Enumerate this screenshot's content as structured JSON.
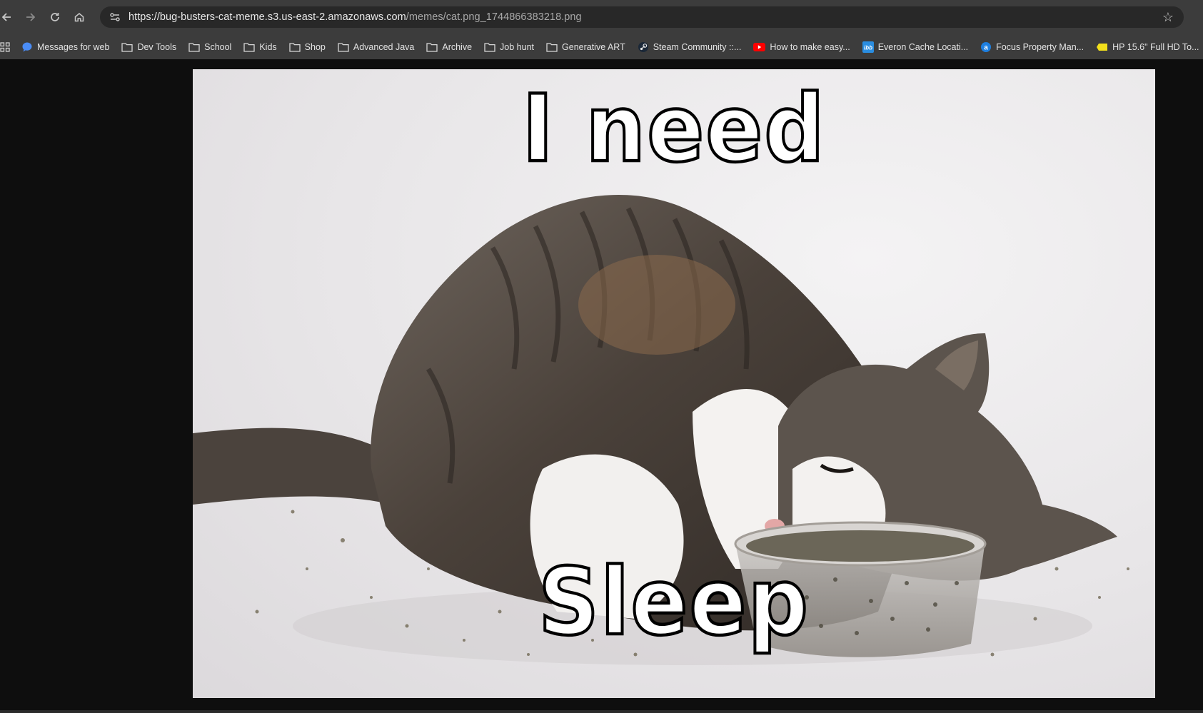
{
  "browser": {
    "url_host": "https://bug-busters-cat-meme.s3.us-east-2.amazonaws.com",
    "url_path": "/memes/cat.png_1744866383218.png",
    "bookmarks": [
      {
        "label": "Messages for web",
        "icon": "messages-icon"
      },
      {
        "label": "Dev Tools",
        "icon": "folder-icon"
      },
      {
        "label": "School",
        "icon": "folder-icon"
      },
      {
        "label": "Kids",
        "icon": "folder-icon"
      },
      {
        "label": "Shop",
        "icon": "folder-icon"
      },
      {
        "label": "Advanced Java",
        "icon": "folder-icon"
      },
      {
        "label": "Archive",
        "icon": "folder-icon"
      },
      {
        "label": "Job hunt",
        "icon": "folder-icon"
      },
      {
        "label": "Generative ART",
        "icon": "folder-icon"
      },
      {
        "label": "Steam Community ::...",
        "icon": "steam-icon"
      },
      {
        "label": "How to make easy...",
        "icon": "youtube-icon"
      },
      {
        "label": "Everon Cache Locati...",
        "icon": "ibb-icon"
      },
      {
        "label": "Focus Property Man...",
        "icon": "focus-icon"
      },
      {
        "label": "HP 15.6\" Full HD To...",
        "icon": "tag-icon"
      }
    ]
  },
  "meme": {
    "top_text": "I need",
    "bottom_text": "Sleep"
  },
  "colors": {
    "chrome_bg": "#3c3c3c",
    "omnibox_bg": "#282828",
    "page_bg": "#0e0e0e"
  }
}
